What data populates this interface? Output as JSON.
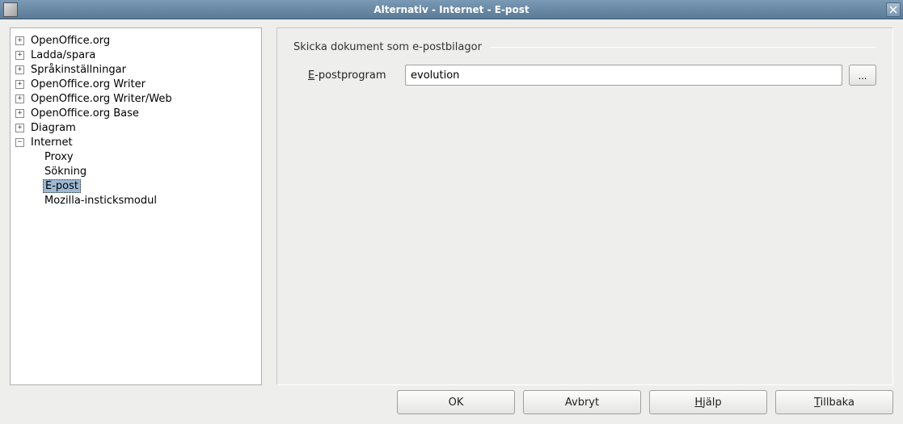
{
  "window": {
    "title": "Alternativ - Internet - E-post"
  },
  "tree": {
    "items": [
      {
        "label": "OpenOffice.org",
        "expanded": false,
        "hasChildren": true
      },
      {
        "label": "Ladda/spara",
        "expanded": false,
        "hasChildren": true
      },
      {
        "label": "Språkinställningar",
        "expanded": false,
        "hasChildren": true
      },
      {
        "label": "OpenOffice.org Writer",
        "expanded": false,
        "hasChildren": true
      },
      {
        "label": "OpenOffice.org Writer/Web",
        "expanded": false,
        "hasChildren": true
      },
      {
        "label": "OpenOffice.org Base",
        "expanded": false,
        "hasChildren": true
      },
      {
        "label": "Diagram",
        "expanded": false,
        "hasChildren": true
      },
      {
        "label": "Internet",
        "expanded": true,
        "hasChildren": true
      }
    ],
    "internet_children": [
      {
        "label": "Proxy",
        "selected": false
      },
      {
        "label": "Sökning",
        "selected": false
      },
      {
        "label": "E-post",
        "selected": true
      },
      {
        "label": "Mozilla-insticksmodul",
        "selected": false
      }
    ]
  },
  "content": {
    "section_title": "Skicka dokument som e-postbilagor",
    "field_label_prefix": "E",
    "field_label_rest": "-postprogram",
    "field_value": "evolution",
    "browse_label": "..."
  },
  "buttons": {
    "ok": "OK",
    "cancel": "Avbryt",
    "help_prefix": "H",
    "help_rest": "jälp",
    "back_prefix": "T",
    "back_rest": "illbaka"
  }
}
